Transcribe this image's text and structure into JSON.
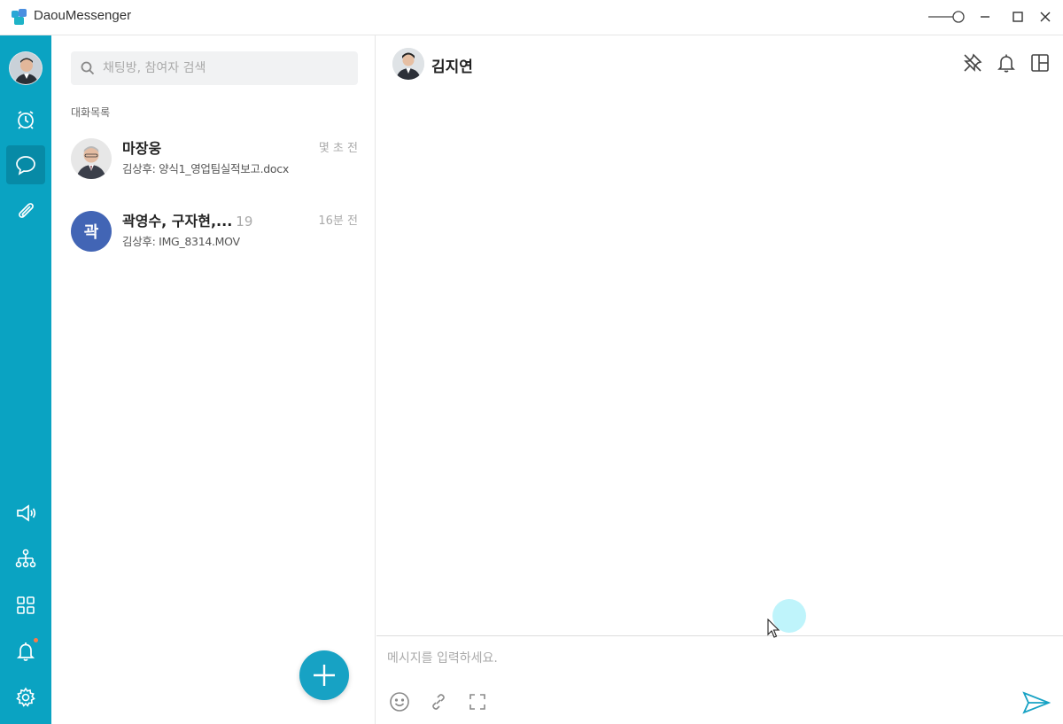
{
  "app": {
    "title": "DaouMessenger"
  },
  "colors": {
    "rail": "#0aa3c2",
    "accent": "#17a2c4",
    "group_avatar": "#4265b5",
    "notification_dot": "#ff7a45"
  },
  "rail": {
    "top_items": [
      {
        "icon": "clock-icon",
        "active": false
      },
      {
        "icon": "chat-bubble-icon",
        "active": true
      },
      {
        "icon": "paperclip-icon",
        "active": false
      }
    ],
    "bottom_items": [
      {
        "icon": "megaphone-icon"
      },
      {
        "icon": "org-chart-icon"
      },
      {
        "icon": "apps-grid-icon"
      },
      {
        "icon": "bell-icon",
        "has_notification": true
      },
      {
        "icon": "gear-icon"
      }
    ]
  },
  "search": {
    "placeholder": "채팅방, 참여자 검색",
    "value": ""
  },
  "list": {
    "section_label": "대화목록",
    "conversations": [
      {
        "name": "마장웅",
        "count": "",
        "time": "몇 초 전",
        "preview": "김상후: 양식1_영업팀실적보고.docx",
        "avatar": "photo"
      },
      {
        "name": "곽영수, 구자현,...",
        "count": "19",
        "time": "16분 전",
        "preview": "김상후: IMG_8314.MOV",
        "avatar": "initial",
        "initial": "곽"
      }
    ]
  },
  "chat": {
    "name": "김지연",
    "header_icons": [
      "pin-icon",
      "bell-icon",
      "panel-layout-icon"
    ],
    "composer": {
      "placeholder": "메시지를 입력하세요.",
      "value": "",
      "tools": [
        "emoji-icon",
        "link-icon",
        "fullscreen-icon"
      ]
    }
  }
}
